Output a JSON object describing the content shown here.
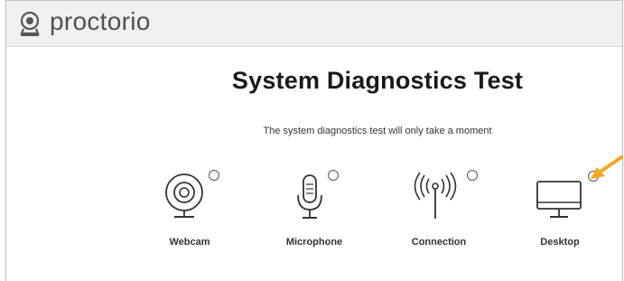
{
  "header": {
    "brand": "proctorio"
  },
  "main": {
    "title": "System Diagnostics Test",
    "subtitle": "The system diagnostics test will only take a moment"
  },
  "checks": [
    {
      "label": "Webcam",
      "icon": "webcam-icon"
    },
    {
      "label": "Microphone",
      "icon": "microphone-icon"
    },
    {
      "label": "Connection",
      "icon": "antenna-icon"
    },
    {
      "label": "Desktop",
      "icon": "monitor-icon"
    }
  ],
  "colors": {
    "header_bg": "#f0f0f0",
    "brand_text": "#505050",
    "annotation_arrow": "#f5a623"
  }
}
